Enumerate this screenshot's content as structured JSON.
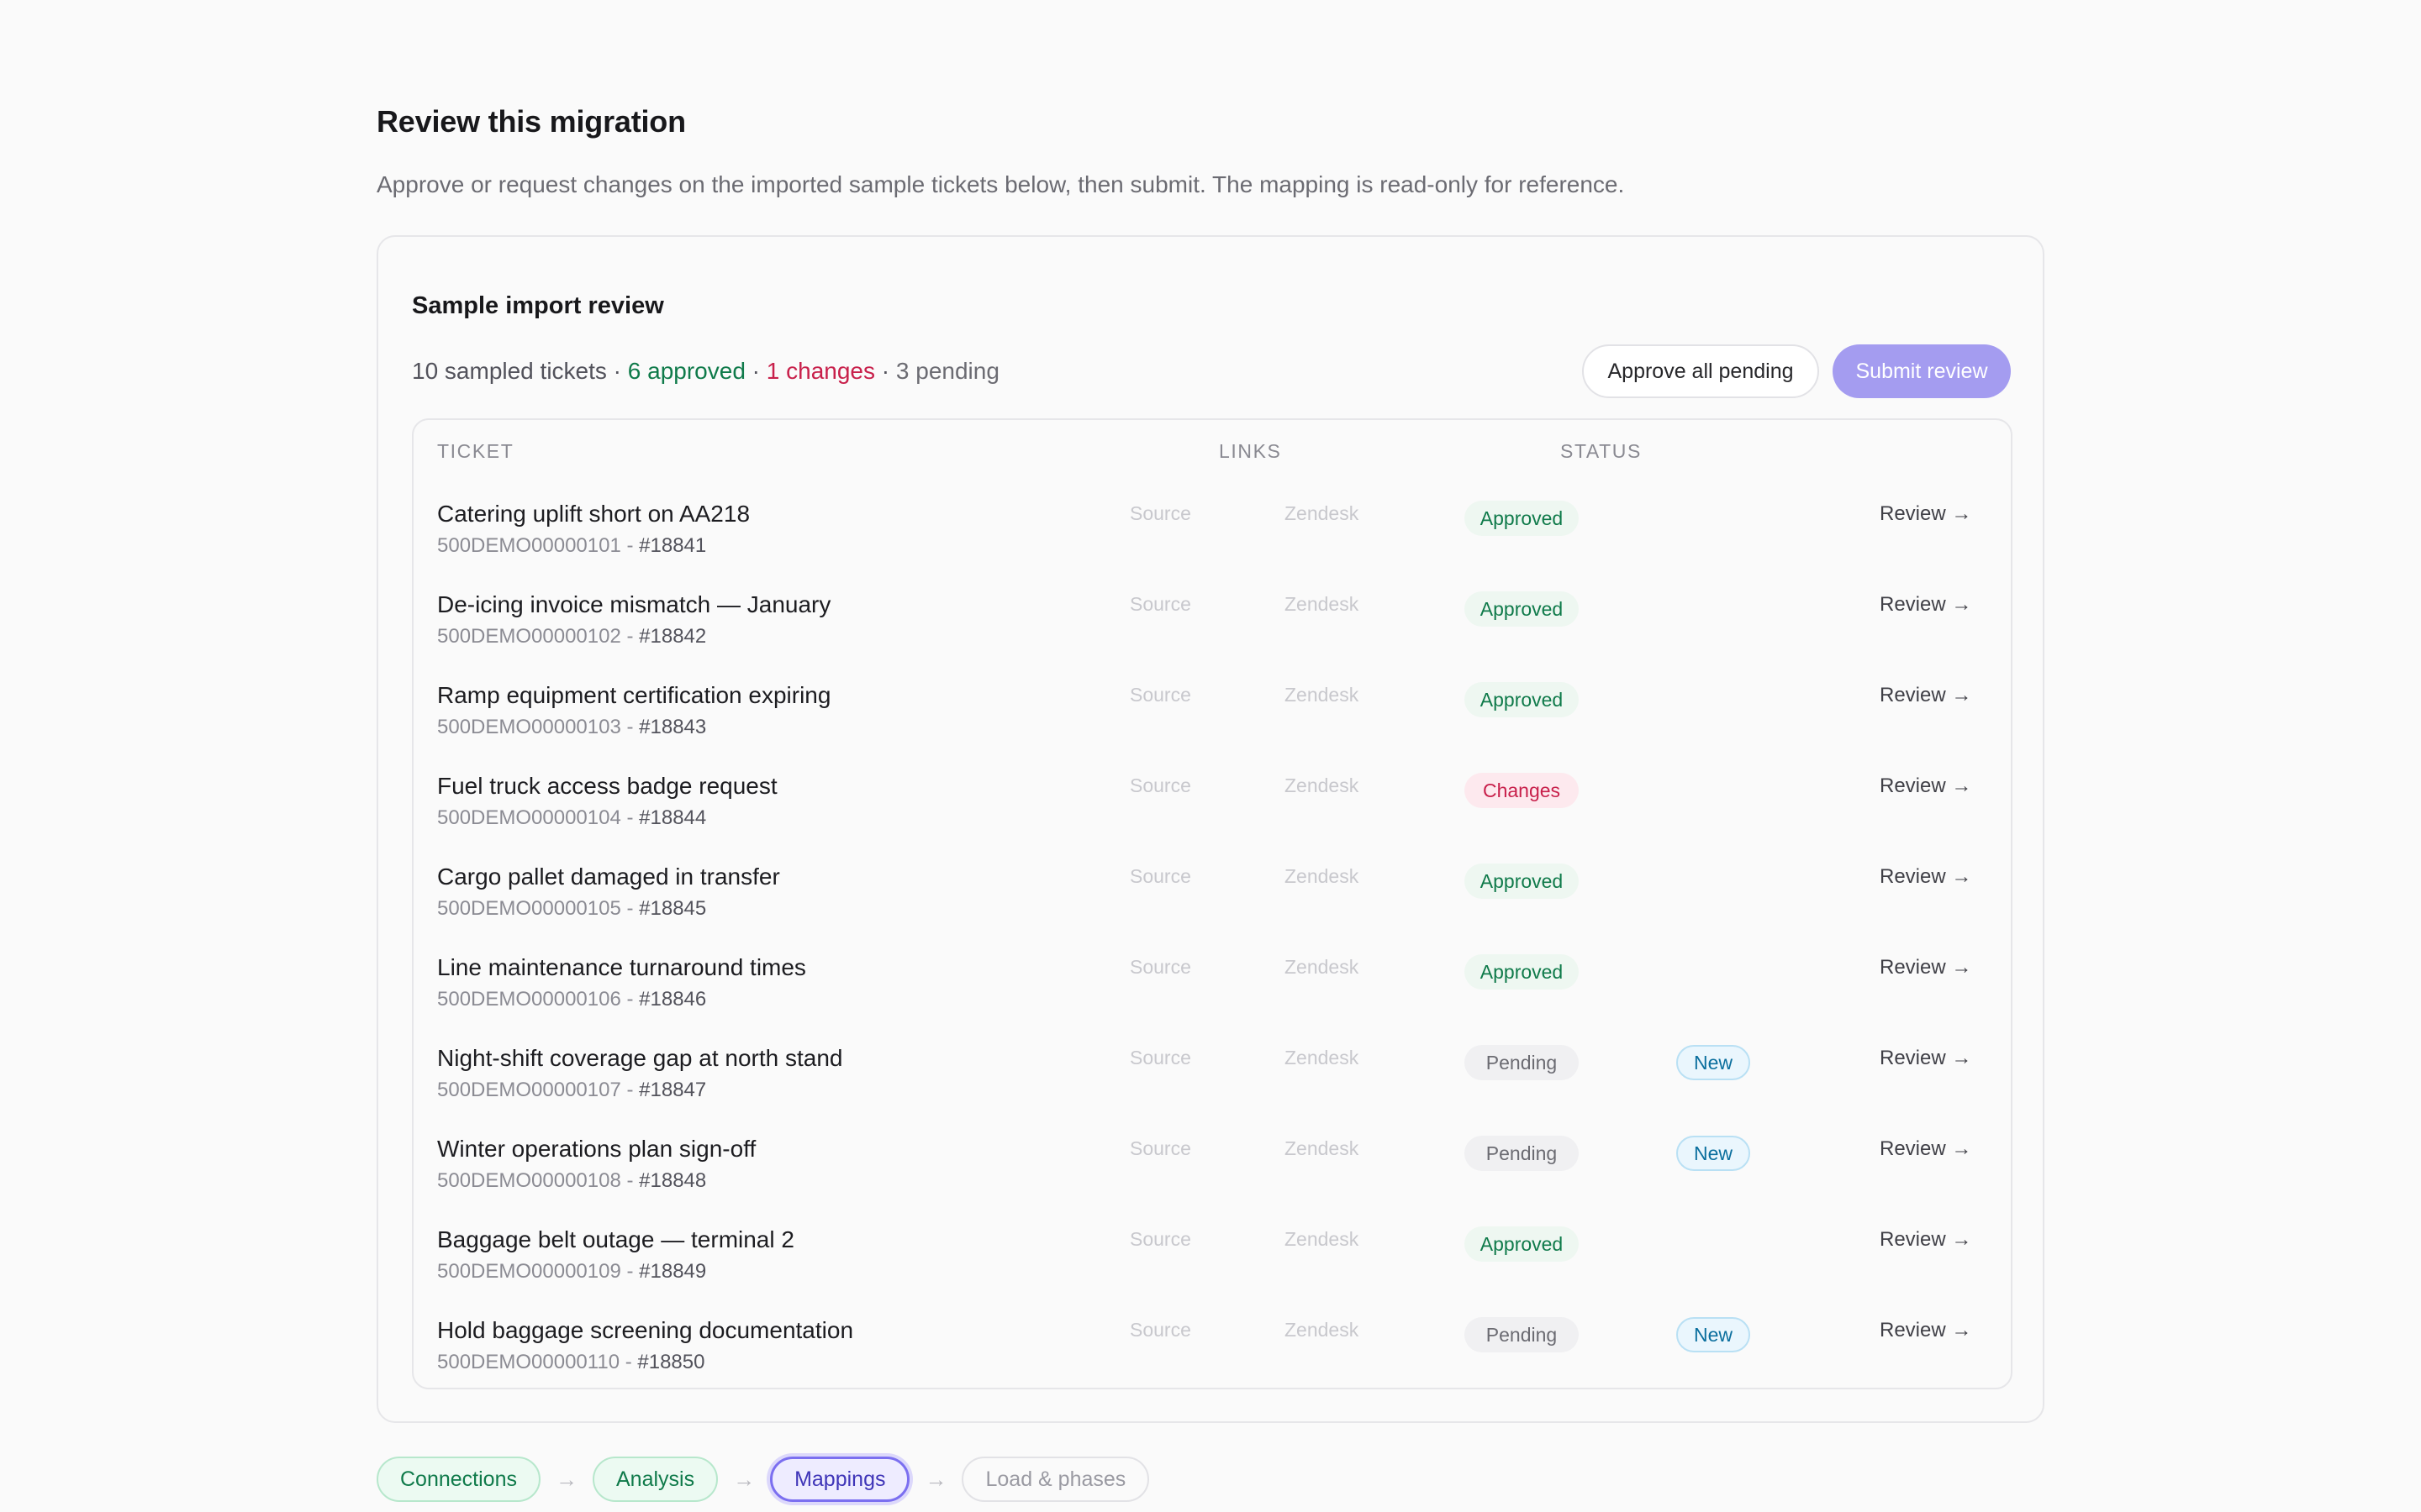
{
  "page": {
    "title": "Review this migration",
    "subtitle": "Approve or request changes on the imported sample tickets below, then submit. The mapping is read-only for reference."
  },
  "review": {
    "title": "Sample import review",
    "summary": {
      "sampled": "10 sampled tickets",
      "sep1": " · ",
      "approved": "6 approved",
      "sep2": " · ",
      "changes": "1 changes",
      "sep3": " · ",
      "pending": "3 pending"
    },
    "approve_all_label": "Approve all pending",
    "submit_label": "Submit review"
  },
  "table": {
    "headers": {
      "ticket": "TICKET",
      "links": "LINKS",
      "status": "STATUS"
    },
    "link_source": "Source",
    "link_zendesk": "Zendesk",
    "review_label": "Review →",
    "new_label": "New",
    "rows": [
      {
        "title": "Catering uplift short on AA218",
        "id": "500DEMO00000101",
        "sep": " - ",
        "number": "#18841",
        "status": "Approved",
        "new": false
      },
      {
        "title": "De-icing invoice mismatch — January",
        "id": "500DEMO00000102",
        "sep": " - ",
        "number": "#18842",
        "status": "Approved",
        "new": false
      },
      {
        "title": "Ramp equipment certification expiring",
        "id": "500DEMO00000103",
        "sep": " - ",
        "number": "#18843",
        "status": "Approved",
        "new": false
      },
      {
        "title": "Fuel truck access badge request",
        "id": "500DEMO00000104",
        "sep": " - ",
        "number": "#18844",
        "status": "Changes",
        "new": false
      },
      {
        "title": "Cargo pallet damaged in transfer",
        "id": "500DEMO00000105",
        "sep": " - ",
        "number": "#18845",
        "status": "Approved",
        "new": false
      },
      {
        "title": "Line maintenance turnaround times",
        "id": "500DEMO00000106",
        "sep": " - ",
        "number": "#18846",
        "status": "Approved",
        "new": false
      },
      {
        "title": "Night-shift coverage gap at north stand",
        "id": "500DEMO00000107",
        "sep": " - ",
        "number": "#18847",
        "status": "Pending",
        "new": true
      },
      {
        "title": "Winter operations plan sign-off",
        "id": "500DEMO00000108",
        "sep": " - ",
        "number": "#18848",
        "status": "Pending",
        "new": true
      },
      {
        "title": "Baggage belt outage — terminal 2",
        "id": "500DEMO00000109",
        "sep": " - ",
        "number": "#18849",
        "status": "Approved",
        "new": false
      },
      {
        "title": "Hold baggage screening documentation",
        "id": "500DEMO00000110",
        "sep": " - ",
        "number": "#18850",
        "status": "Pending",
        "new": true
      }
    ]
  },
  "steps": {
    "connections": "Connections",
    "analysis": "Analysis",
    "mappings": "Mappings",
    "load": "Load & phases",
    "arrow": "→",
    "current": "Mappings"
  },
  "colors": {
    "approved": "#0f7a4a",
    "changes": "#c8204b",
    "pending": "#6b6b72",
    "accent": "#a49cf0",
    "new_badge": "#0b6f9e"
  }
}
